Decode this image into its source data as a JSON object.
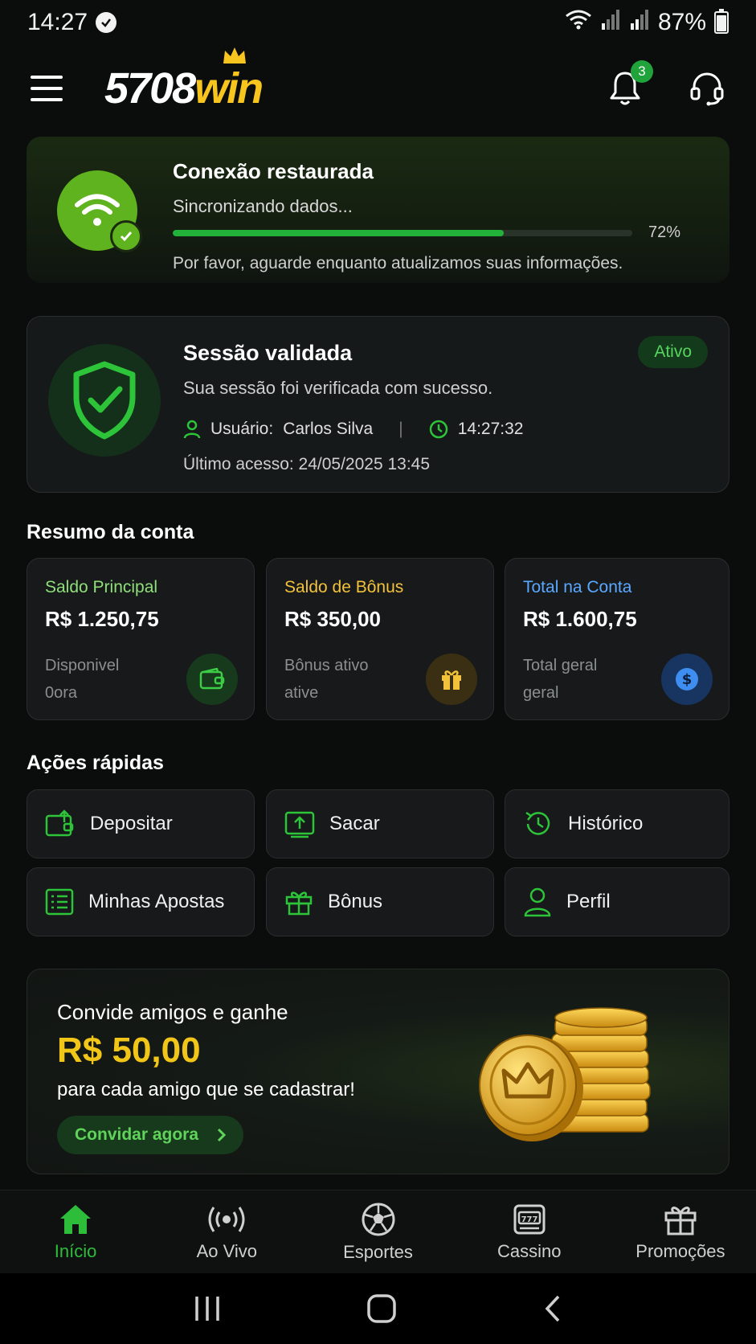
{
  "status_bar": {
    "time": "14:27",
    "battery": "87%"
  },
  "header": {
    "logo_num": "5708",
    "logo_win": "win",
    "notifications_count": "3"
  },
  "connection": {
    "title": "Conexão restaurada",
    "subtitle": "Sincronizando dados...",
    "progress": 72,
    "progress_label": "72%",
    "note": "Por favor, aguarde enquanto atualizamos suas informações."
  },
  "session": {
    "title": "Sessão validada",
    "subtitle": "Sua sessão foi verificada com sucesso.",
    "badge": "Ativo",
    "user_label": "Usuário:",
    "user_name": "Carlos Silva",
    "time": "14:27:32",
    "last_access": "Último acesso: 24/05/2025 13:45"
  },
  "summary": {
    "title": "Resumo da conta",
    "cards": [
      {
        "label": "Saldo Principal",
        "value": "R$ 1.250,75",
        "note1": "Disponivel",
        "note2": "0ora"
      },
      {
        "label": "Saldo de Bônus",
        "value": "R$ 350,00",
        "note1": "Bônus ativo",
        "note2": "ative"
      },
      {
        "label": "Total na Conta",
        "value": "R$ 1.600,75",
        "note1": "Total geral",
        "note2": "geral"
      }
    ]
  },
  "quick_actions": {
    "title": "Ações rápidas",
    "items": [
      "Depositar",
      "Sacar",
      "Histórico",
      "Minhas Apostas",
      "Bônus",
      "Perfil"
    ]
  },
  "invite": {
    "line1": "Convide amigos e ganhe",
    "amount": "R$ 50,00",
    "line2": "para cada amigo que se cadastrar!",
    "button": "Convidar agora"
  },
  "bottom_nav": {
    "items": [
      "Início",
      "Ao Vivo",
      "Esportes",
      "Cassino",
      "Promoções"
    ],
    "active": "Início"
  },
  "colors": {
    "accent_green": "#22b23a",
    "gold": "#f2c618",
    "blue": "#4da3ff"
  }
}
